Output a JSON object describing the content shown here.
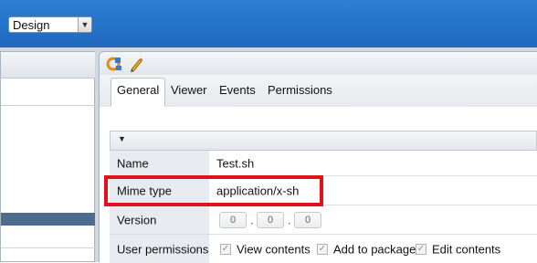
{
  "topbar": {
    "mode_select": "Design"
  },
  "toolbar": {
    "icons": [
      "refresh-icon",
      "pencil-icon"
    ]
  },
  "tabs": [
    "General",
    "Viewer",
    "Events",
    "Permissions"
  ],
  "form": {
    "name_label": "Name",
    "name_value": "Test.sh",
    "mime_label": "Mime type",
    "mime_value": "application/x-sh",
    "version_label": "Version",
    "version": [
      "0",
      "0",
      "0"
    ],
    "perm_label": "User permissions",
    "permissions": [
      "View contents",
      "Add to package",
      "Edit contents"
    ]
  },
  "colors": {
    "topbar": "#2473cb",
    "highlight": "#e0121c",
    "label_bg": "#e7ebf0"
  }
}
